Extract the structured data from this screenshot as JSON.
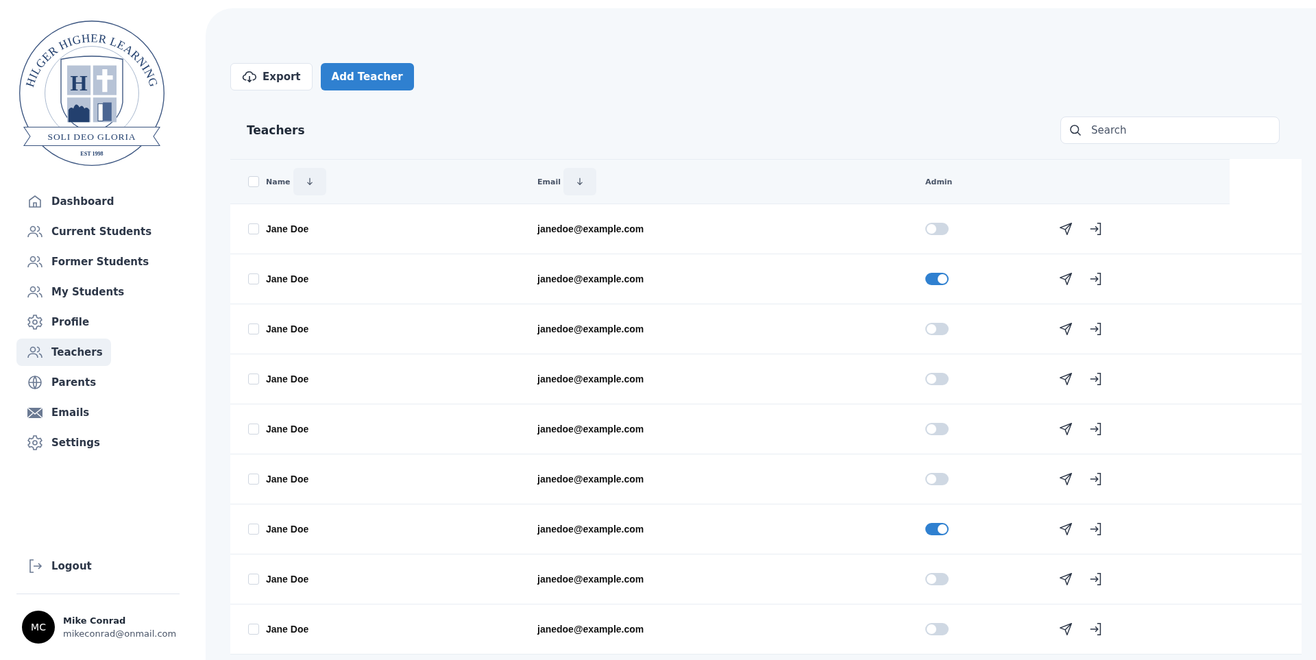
{
  "logo": {
    "arc_text": "HILGER HIGHER LEARNING",
    "letter": "H",
    "motto": "SOLI DEO GLORIA",
    "established": "EST 1998"
  },
  "sidebar": {
    "items": [
      {
        "label": "Dashboard",
        "kind": "home",
        "selected": false
      },
      {
        "label": "Current Students",
        "kind": "users",
        "selected": false
      },
      {
        "label": "Former Students",
        "kind": "users",
        "selected": false
      },
      {
        "label": "My Students",
        "kind": "users",
        "selected": false
      },
      {
        "label": "Profile",
        "kind": "gear",
        "selected": false
      },
      {
        "label": "Teachers",
        "kind": "users",
        "selected": true
      },
      {
        "label": "Parents",
        "kind": "globe",
        "selected": false
      },
      {
        "label": "Emails",
        "kind": "mail",
        "selected": false
      },
      {
        "label": "Settings",
        "kind": "gear",
        "selected": false
      }
    ],
    "logout": "Logout",
    "user": {
      "initials": "MC",
      "name": "Mike Conrad",
      "email": "mikeconrad@onmail.com"
    }
  },
  "toolbar": {
    "export": "Export",
    "add": "Add Teacher"
  },
  "table": {
    "title": "Teachers",
    "all_checked": false,
    "search": {
      "placeholder": "Search"
    },
    "columns": [
      {
        "label": "Name",
        "sortable": true
      },
      {
        "label": "Email",
        "sortable": true
      },
      {
        "label": "Admin",
        "sortable": false
      }
    ],
    "rows": [
      {
        "name": "Jane Doe",
        "email": "janedoe@example.com",
        "admin": false,
        "checked": false
      },
      {
        "name": "Jane Doe",
        "email": "janedoe@example.com",
        "admin": true,
        "checked": false
      },
      {
        "name": "Jane Doe",
        "email": "janedoe@example.com",
        "admin": false,
        "checked": false
      },
      {
        "name": "Jane Doe",
        "email": "janedoe@example.com",
        "admin": false,
        "checked": false
      },
      {
        "name": "Jane Doe",
        "email": "janedoe@example.com",
        "admin": false,
        "checked": false
      },
      {
        "name": "Jane Doe",
        "email": "janedoe@example.com",
        "admin": false,
        "checked": false
      },
      {
        "name": "Jane Doe",
        "email": "janedoe@example.com",
        "admin": true,
        "checked": false
      },
      {
        "name": "Jane Doe",
        "email": "janedoe@example.com",
        "admin": false,
        "checked": false
      },
      {
        "name": "Jane Doe",
        "email": "janedoe@example.com",
        "admin": false,
        "checked": false
      }
    ]
  }
}
